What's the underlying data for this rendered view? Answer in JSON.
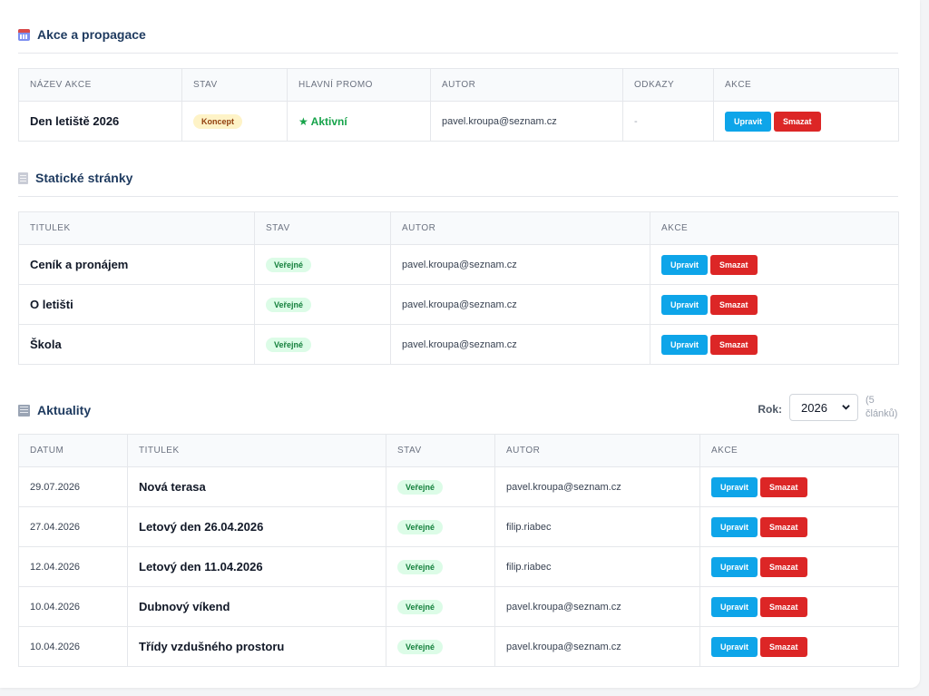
{
  "events": {
    "title": "Akce a propagace",
    "columns": [
      "NÁZEV AKCE",
      "STAV",
      "HLAVNÍ PROMO",
      "AUTOR",
      "ODKAZY",
      "AKCE"
    ],
    "rows": [
      {
        "name": "Den letiště 2026",
        "status": "Koncept",
        "promo": "★ Aktivní",
        "author": "pavel.kroupa@seznam.cz",
        "links": "-"
      }
    ]
  },
  "pages": {
    "title": "Statické stránky",
    "columns": [
      "TITULEK",
      "STAV",
      "AUTOR",
      "AKCE"
    ],
    "rows": [
      {
        "title": "Ceník a pronájem",
        "status": "Veřejné",
        "author": "pavel.kroupa@seznam.cz"
      },
      {
        "title": "O letišti",
        "status": "Veřejné",
        "author": "pavel.kroupa@seznam.cz"
      },
      {
        "title": "Škola",
        "status": "Veřejné",
        "author": "pavel.kroupa@seznam.cz"
      }
    ]
  },
  "news": {
    "title": "Aktuality",
    "year_label": "Rok:",
    "year_value": "2026",
    "count_text": "(5 článků)",
    "columns": [
      "DATUM",
      "TITULEK",
      "STAV",
      "AUTOR",
      "AKCE"
    ],
    "rows": [
      {
        "date": "29.07.2026",
        "title": "Nová terasa",
        "status": "Veřejné",
        "author": "pavel.kroupa@seznam.cz"
      },
      {
        "date": "27.04.2026",
        "title": "Letový den 26.04.2026",
        "status": "Veřejné",
        "author": "filip.riabec"
      },
      {
        "date": "12.04.2026",
        "title": "Letový den 11.04.2026",
        "status": "Veřejné",
        "author": "filip.riabec"
      },
      {
        "date": "10.04.2026",
        "title": "Dubnový víkend",
        "status": "Veřejné",
        "author": "pavel.kroupa@seznam.cz"
      },
      {
        "date": "10.04.2026",
        "title": "Třídy vzdušného prostoru",
        "status": "Veřejné",
        "author": "pavel.kroupa@seznam.cz"
      }
    ]
  },
  "actions": {
    "edit_label": "Upravit",
    "delete_label": "Smazat"
  },
  "icons": {
    "events": "calendar-icon",
    "pages": "page-icon",
    "news": "newspaper-icon",
    "select": "chevron-down-icon"
  },
  "colors": {
    "accent_blue": "#0ea5e9",
    "danger_red": "#dc2626",
    "success_green": "#16a34a"
  }
}
